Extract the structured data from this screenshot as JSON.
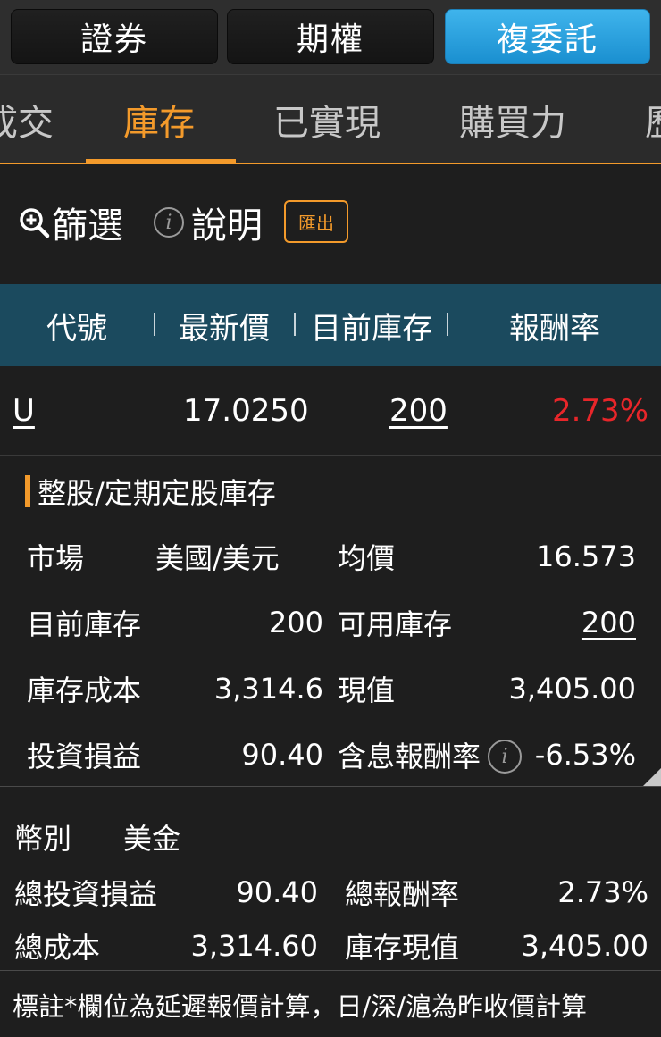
{
  "top_tabs": {
    "securities": "證券",
    "options": "期權",
    "multi_order": "複委託"
  },
  "sub_tabs": {
    "filled_partial": "成交",
    "inventory": "庫存",
    "realized": "已實現",
    "buying_power": "購買力",
    "history_partial": "歷"
  },
  "toolbar": {
    "filter_label": "篩選",
    "help_label": "說明",
    "info_glyph": "i",
    "export_label": "匯出"
  },
  "table": {
    "headers": {
      "code": "代號",
      "last_price": "最新價",
      "current_inventory": "目前庫存",
      "return_rate": "報酬率"
    },
    "row": {
      "code": "U",
      "last_price": "17.0250",
      "current_inventory": "200",
      "return_rate": "2.73%"
    }
  },
  "detail": {
    "title": "整股/定期定股庫存",
    "market_label": "市場",
    "market_value": "美國/美元",
    "avg_price_label": "均價",
    "avg_price_value": "16.573",
    "current_inventory_label": "目前庫存",
    "current_inventory_value": "200",
    "available_inventory_label": "可用庫存",
    "available_inventory_value": "200",
    "inventory_cost_label": "庫存成本",
    "inventory_cost_value": "3,314.6",
    "present_value_label": "現值",
    "present_value_value": "3,405.00",
    "investment_pl_label": "投資損益",
    "investment_pl_value": "90.40",
    "dividend_return_label": "含息報酬率",
    "dividend_return_value": "-6.53%"
  },
  "summary": {
    "currency_label": "幣別",
    "currency_value": "美金",
    "total_pl_label": "總投資損益",
    "total_pl_value": "90.40",
    "total_return_label": "總報酬率",
    "total_return_value": "2.73%",
    "total_cost_label": "總成本",
    "total_cost_value": "3,314.60",
    "inventory_value_label": "庫存現值",
    "inventory_value_value": "3,405.00"
  },
  "footnote": "標註*欄位為延遲報價計算，日/深/滬為昨收價計算",
  "colors": {
    "accent_orange": "#f39a2b",
    "active_blue": "#2ea2e0",
    "header_teal": "#1b4a5e",
    "positive_red": "#e8262a",
    "negative_green": "#3dd63d"
  }
}
